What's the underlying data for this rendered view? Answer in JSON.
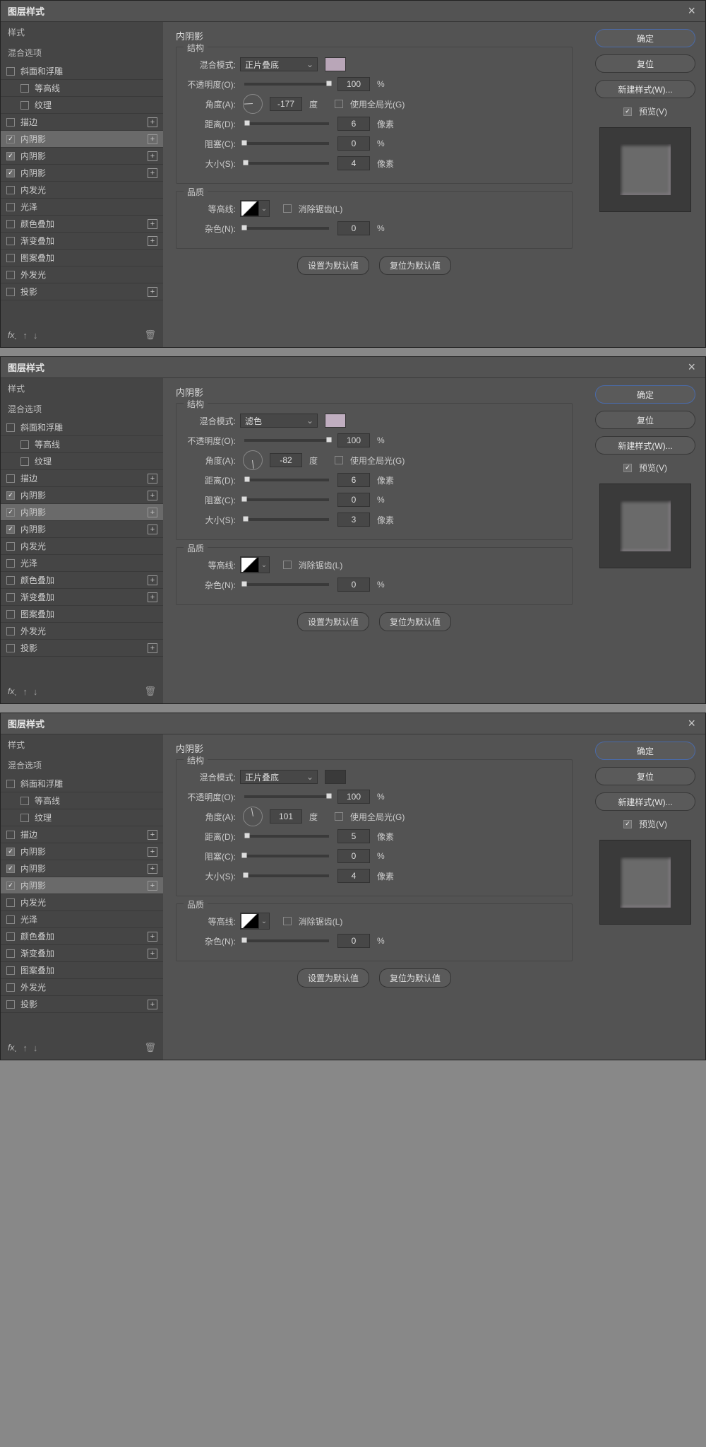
{
  "dialogs": [
    {
      "title": "图层样式",
      "sidebar": {
        "header": "样式",
        "blend": "混合选项"
      },
      "styles": [
        {
          "label": "斜面和浮雕",
          "checked": false,
          "plus": false,
          "indent": false
        },
        {
          "label": "等高线",
          "checked": false,
          "plus": false,
          "indent": true
        },
        {
          "label": "纹理",
          "checked": false,
          "plus": false,
          "indent": true
        },
        {
          "label": "描边",
          "checked": false,
          "plus": true,
          "indent": false
        },
        {
          "label": "内阴影",
          "checked": true,
          "plus": true,
          "indent": false,
          "selected": true
        },
        {
          "label": "内阴影",
          "checked": true,
          "plus": true,
          "indent": false
        },
        {
          "label": "内阴影",
          "checked": true,
          "plus": true,
          "indent": false
        },
        {
          "label": "内发光",
          "checked": false,
          "plus": false,
          "indent": false
        },
        {
          "label": "光泽",
          "checked": false,
          "plus": false,
          "indent": false
        },
        {
          "label": "颜色叠加",
          "checked": false,
          "plus": true,
          "indent": false
        },
        {
          "label": "渐变叠加",
          "checked": false,
          "plus": true,
          "indent": false
        },
        {
          "label": "图案叠加",
          "checked": false,
          "plus": false,
          "indent": false
        },
        {
          "label": "外发光",
          "checked": false,
          "plus": false,
          "indent": false
        },
        {
          "label": "投影",
          "checked": false,
          "plus": true,
          "indent": false
        }
      ],
      "panel": {
        "title": "内阴影",
        "group1": "结构",
        "group2": "品质",
        "blend_label": "混合模式:",
        "blend_value": "正片叠底",
        "swatch": "#b9a6b8",
        "opacity_label": "不透明度(O):",
        "opacity": "100",
        "pct": "%",
        "angle_label": "角度(A):",
        "angle": "-177",
        "deg": "度",
        "global_label": "使用全局光(G)",
        "global": false,
        "distance_label": "距离(D):",
        "distance": "6",
        "px": "像素",
        "choke_label": "阻塞(C):",
        "choke": "0",
        "size_label": "大小(S):",
        "size": "4",
        "contour_label": "等高线:",
        "aa_label": "消除锯齿(L)",
        "aa": false,
        "noise_label": "杂色(N):",
        "noise": "0",
        "btn_default": "设置为默认值",
        "btn_reset": "复位为默认值"
      },
      "right": {
        "ok": "确定",
        "cancel": "复位",
        "newstyle": "新建样式(W)...",
        "preview": "预览(V)",
        "preview_on": true
      }
    },
    {
      "title": "图层样式",
      "sidebar": {
        "header": "样式",
        "blend": "混合选项"
      },
      "styles": [
        {
          "label": "斜面和浮雕",
          "checked": false,
          "plus": false,
          "indent": false
        },
        {
          "label": "等高线",
          "checked": false,
          "plus": false,
          "indent": true
        },
        {
          "label": "纹理",
          "checked": false,
          "plus": false,
          "indent": true
        },
        {
          "label": "描边",
          "checked": false,
          "plus": true,
          "indent": false
        },
        {
          "label": "内阴影",
          "checked": true,
          "plus": true,
          "indent": false
        },
        {
          "label": "内阴影",
          "checked": true,
          "plus": true,
          "indent": false,
          "selected": true
        },
        {
          "label": "内阴影",
          "checked": true,
          "plus": true,
          "indent": false
        },
        {
          "label": "内发光",
          "checked": false,
          "plus": false,
          "indent": false
        },
        {
          "label": "光泽",
          "checked": false,
          "plus": false,
          "indent": false
        },
        {
          "label": "颜色叠加",
          "checked": false,
          "plus": true,
          "indent": false
        },
        {
          "label": "渐变叠加",
          "checked": false,
          "plus": true,
          "indent": false
        },
        {
          "label": "图案叠加",
          "checked": false,
          "plus": false,
          "indent": false
        },
        {
          "label": "外发光",
          "checked": false,
          "plus": false,
          "indent": false
        },
        {
          "label": "投影",
          "checked": false,
          "plus": true,
          "indent": false
        }
      ],
      "panel": {
        "title": "内阴影",
        "group1": "结构",
        "group2": "品质",
        "blend_label": "混合模式:",
        "blend_value": "滤色",
        "swatch": "#c0aec0",
        "opacity_label": "不透明度(O):",
        "opacity": "100",
        "pct": "%",
        "angle_label": "角度(A):",
        "angle": "-82",
        "deg": "度",
        "global_label": "使用全局光(G)",
        "global": false,
        "distance_label": "距离(D):",
        "distance": "6",
        "px": "像素",
        "choke_label": "阻塞(C):",
        "choke": "0",
        "size_label": "大小(S):",
        "size": "3",
        "contour_label": "等高线:",
        "aa_label": "消除锯齿(L)",
        "aa": false,
        "noise_label": "杂色(N):",
        "noise": "0",
        "btn_default": "设置为默认值",
        "btn_reset": "复位为默认值"
      },
      "right": {
        "ok": "确定",
        "cancel": "复位",
        "newstyle": "新建样式(W)...",
        "preview": "预览(V)",
        "preview_on": true
      }
    },
    {
      "title": "图层样式",
      "sidebar": {
        "header": "样式",
        "blend": "混合选项"
      },
      "styles": [
        {
          "label": "斜面和浮雕",
          "checked": false,
          "plus": false,
          "indent": false
        },
        {
          "label": "等高线",
          "checked": false,
          "plus": false,
          "indent": true
        },
        {
          "label": "纹理",
          "checked": false,
          "plus": false,
          "indent": true
        },
        {
          "label": "描边",
          "checked": false,
          "plus": true,
          "indent": false
        },
        {
          "label": "内阴影",
          "checked": true,
          "plus": true,
          "indent": false
        },
        {
          "label": "内阴影",
          "checked": true,
          "plus": true,
          "indent": false
        },
        {
          "label": "内阴影",
          "checked": true,
          "plus": true,
          "indent": false,
          "selected": true
        },
        {
          "label": "内发光",
          "checked": false,
          "plus": false,
          "indent": false
        },
        {
          "label": "光泽",
          "checked": false,
          "plus": false,
          "indent": false
        },
        {
          "label": "颜色叠加",
          "checked": false,
          "plus": true,
          "indent": false
        },
        {
          "label": "渐变叠加",
          "checked": false,
          "plus": true,
          "indent": false
        },
        {
          "label": "图案叠加",
          "checked": false,
          "plus": false,
          "indent": false
        },
        {
          "label": "外发光",
          "checked": false,
          "plus": false,
          "indent": false
        },
        {
          "label": "投影",
          "checked": false,
          "plus": true,
          "indent": false
        }
      ],
      "panel": {
        "title": "内阴影",
        "group1": "结构",
        "group2": "品质",
        "blend_label": "混合模式:",
        "blend_value": "正片叠底",
        "swatch": "#3a3a3a",
        "opacity_label": "不透明度(O):",
        "opacity": "100",
        "pct": "%",
        "angle_label": "角度(A):",
        "angle": "101",
        "deg": "度",
        "global_label": "使用全局光(G)",
        "global": false,
        "distance_label": "距离(D):",
        "distance": "5",
        "px": "像素",
        "choke_label": "阻塞(C):",
        "choke": "0",
        "size_label": "大小(S):",
        "size": "4",
        "contour_label": "等高线:",
        "aa_label": "消除锯齿(L)",
        "aa": false,
        "noise_label": "杂色(N):",
        "noise": "0",
        "btn_default": "设置为默认值",
        "btn_reset": "复位为默认值"
      },
      "right": {
        "ok": "确定",
        "cancel": "复位",
        "newstyle": "新建样式(W)...",
        "preview": "预览(V)",
        "preview_on": true
      }
    }
  ],
  "fx_label": "fx"
}
